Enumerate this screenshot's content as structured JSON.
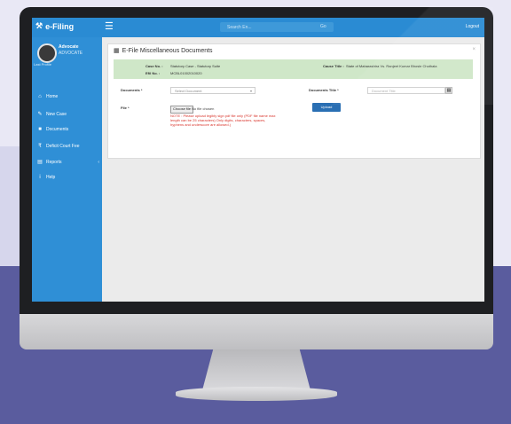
{
  "app": {
    "brand": "e-Filing",
    "search_placeholder": "Search En...",
    "search_go": "Go",
    "logout": "Logout"
  },
  "user": {
    "name": "Advocate",
    "role": "ADVOCATE",
    "sub": "Last Profile"
  },
  "sidebar": {
    "items": [
      {
        "label": "Home",
        "icon": "home-icon"
      },
      {
        "label": "New Case",
        "icon": "edit-icon"
      },
      {
        "label": "Documents",
        "icon": "document-icon"
      },
      {
        "label": "Deficit Court Fee",
        "icon": "rupee-icon"
      },
      {
        "label": "Reports",
        "icon": "report-icon"
      },
      {
        "label": "Help",
        "icon": "info-icon"
      }
    ]
  },
  "panel": {
    "title": "E-File Miscellaneous Documents",
    "case_no_label": "Case No. :",
    "case_no_value": "Statutory Case - Statutory Suite",
    "efil_no_label": "Efil No. :",
    "efil_no_value": "MCBL01002010020",
    "cause_title_label": "Cause Title :",
    "cause_title_value": "State of Maharashtra Vs. Ranjeet Kumar Bhosle Chothala",
    "documents_label": "Documents *",
    "documents_select": "Select Document",
    "document_title_label": "Documents Title *",
    "document_title_placeholder": "Document Title",
    "file_label": "File *",
    "choose_file": "Choose file",
    "no_file": "No file chosen",
    "note": "NOTE : Please upload legibly sign pdf file only (PDF file name max length can be 25 characters) Only digits, characters, spaces, hyphens and underscore are allowed.)",
    "upload_button": "Upload"
  }
}
